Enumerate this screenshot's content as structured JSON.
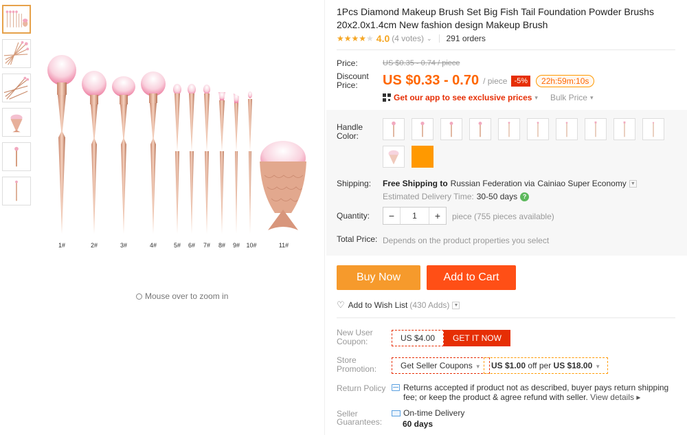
{
  "product": {
    "title": "1Pcs Diamond Makeup Brush Set Big Fish Tail Foundation Powder Brushs 20x2.0x1.4cm New fashion design Makeup Brush",
    "rating": 4.0,
    "rating_text": "4.0",
    "votes": "(4 votes)",
    "orders": "291 orders"
  },
  "gallery": {
    "thumbnails": [
      "brush-set-thumb",
      "brush-fan-thumb",
      "brush-fan-2-thumb",
      "fish-tail-brush-thumb",
      "single-brush-thumb",
      "single-brush-2-thumb"
    ],
    "brush_labels": [
      "1#",
      "2#",
      "3#",
      "4#",
      "5#",
      "6#",
      "7#",
      "8#",
      "9#",
      "10#",
      "11#"
    ],
    "zoom_hint": "Mouse over to zoom in"
  },
  "price": {
    "label": "Price:",
    "original": "US $0.35 - 0.74 / piece",
    "discount_label_1": "Discount",
    "discount_label_2": "Price:",
    "current": "US $0.33 - 0.70",
    "per": "/ piece",
    "discount": "-5%",
    "timer": "22h:59m:10s",
    "app_promo": "Get our app to see exclusive prices",
    "bulk": "Bulk Price"
  },
  "options": {
    "handle_label_1": "Handle",
    "handle_label_2": "Color:",
    "swatch_count": 12,
    "accent_orange": "#ff9900"
  },
  "shipping": {
    "label": "Shipping:",
    "free": "Free Shipping to",
    "country": "Russian Federation via",
    "carrier": "Cainiao Super Economy",
    "est_label": "Estimated Delivery Time:",
    "est_days": "30-50 days"
  },
  "quantity": {
    "label": "Quantity:",
    "value": "1",
    "minus": "−",
    "plus": "+",
    "available": "piece (755 pieces available)"
  },
  "total": {
    "label": "Total Price:",
    "text": "Depends on the product properties you select"
  },
  "actions": {
    "buy_now": "Buy Now",
    "add_to_cart": "Add to Cart",
    "wish_list": "Add to Wish List",
    "wish_count": "(430 Adds)"
  },
  "coupons": {
    "new_user_label_1": "New User",
    "new_user_label_2": "Coupon:",
    "new_user_amount": "US $4.00",
    "get_it_now": "GET IT NOW",
    "store_label_1": "Store",
    "store_label_2": "Promotion:",
    "seller_coupons": "Get Seller Coupons",
    "offer_pre": "US $1.00",
    "offer_mid": "off per",
    "offer_post": "US $18.00"
  },
  "policy": {
    "return_label": "Return Policy",
    "return_text": "Returns accepted if product not as described, buyer pays return shipping fee; or keep the product & agree refund with seller.",
    "view_details": "View details ▸",
    "guarantee_label_1": "Seller",
    "guarantee_label_2": "Guarantees:",
    "on_time": "On-time Delivery",
    "days": "60 days"
  }
}
